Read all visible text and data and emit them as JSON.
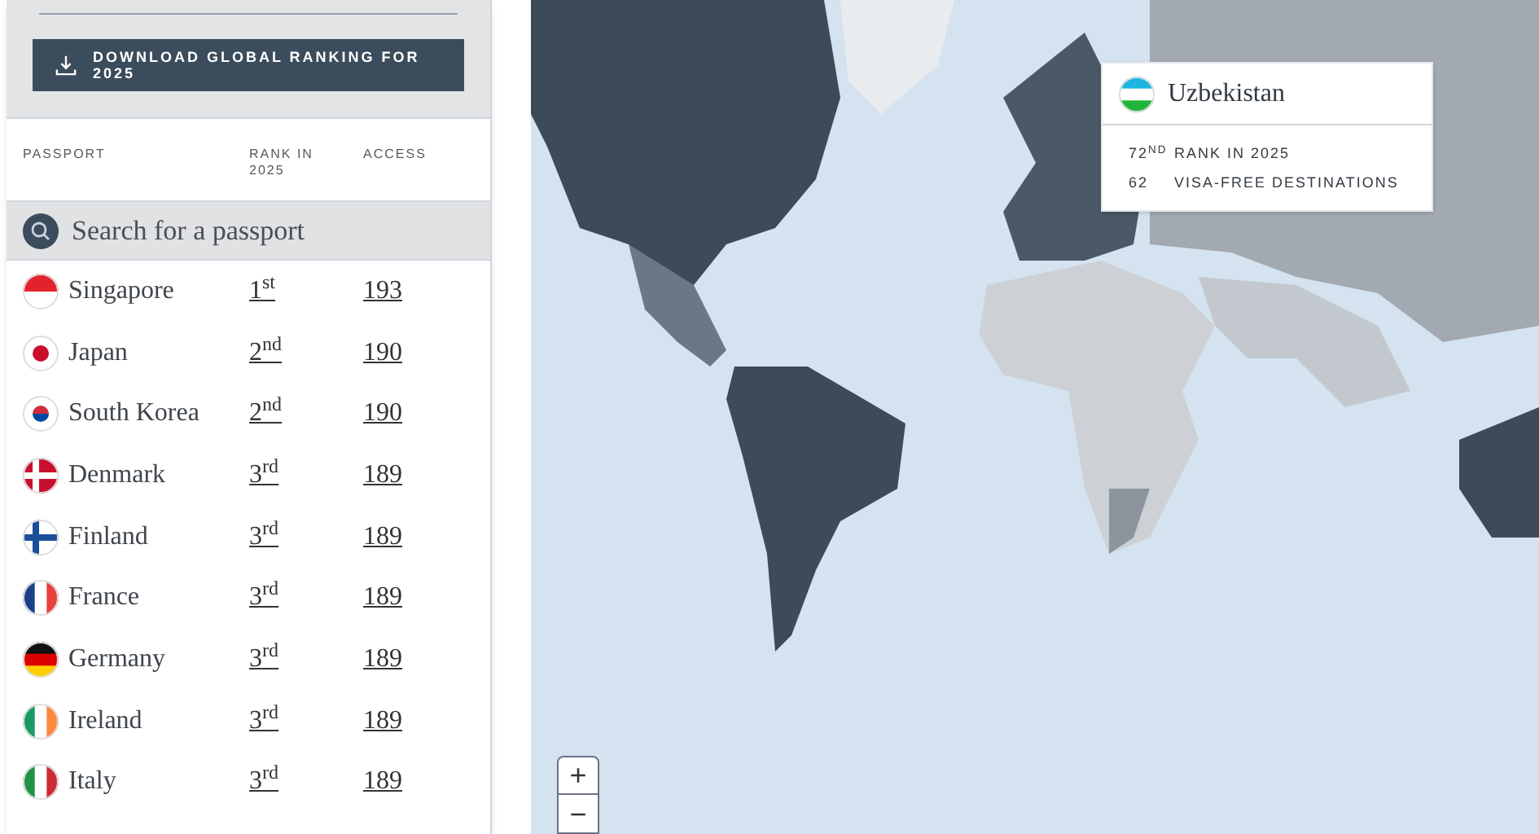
{
  "download_button": {
    "label": "DOWNLOAD GLOBAL RANKING FOR 2025"
  },
  "table": {
    "columns": [
      "PASSPORT",
      "RANK IN 2025",
      "ACCESS"
    ],
    "search": {
      "placeholder": "Search for a passport"
    },
    "rows": [
      {
        "country": "Singapore",
        "rank": "1$^{st}$",
        "access": "193",
        "kind": "red_white_h"
      },
      {
        "country": "Japan",
        "rank": "2$^{nd}$",
        "access": "190",
        "kind": "red_disc"
      },
      {
        "country": "South Korea",
        "rank": "2$^{nd}$",
        "access": "190",
        "kind": "taegeuk"
      },
      {
        "country": "Denmark",
        "rank": "3$^{rd}$",
        "access": "189",
        "kind": "red_cross"
      },
      {
        "country": "Finland",
        "rank": "3$^{rd}$",
        "access": "189",
        "kind": "blue_cross"
      },
      {
        "country": "France",
        "rank": "3$^{rd}$",
        "access": "189",
        "kind": "blue_white_red_v"
      },
      {
        "country": "Germany",
        "rank": "3$^{rd}$",
        "access": "189",
        "kind": "black_red_gold_h"
      },
      {
        "country": "Ireland",
        "rank": "3$^{rd}$",
        "access": "189",
        "kind": "green_white_orange_v"
      },
      {
        "country": "Italy",
        "rank": "3$^{rd}$",
        "access": "189",
        "kind": "green_white_red_v"
      }
    ]
  },
  "tooltip": {
    "country": "Uzbekistan",
    "kind": "blue_white_green_h",
    "stats": [
      {
        "value": "72$^{ND}$",
        "label": "RANK IN 2025"
      },
      {
        "value": "62",
        "label": "VISA-FREE DESTINATIONS"
      }
    ]
  },
  "zoom_controls": [
    "+",
    "−"
  ]
}
